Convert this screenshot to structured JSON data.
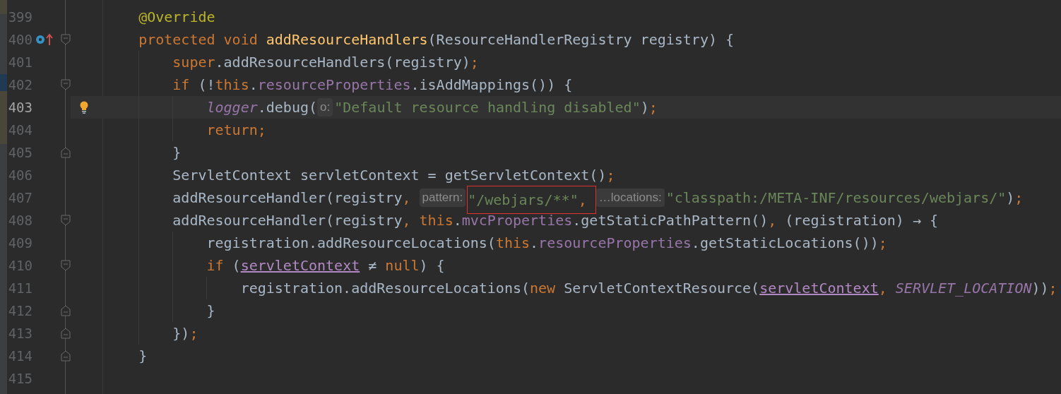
{
  "editor": {
    "lines": [
      {
        "number": "399",
        "current": false,
        "tokens": [
          {
            "kind": "annotation",
            "text": "@Override"
          }
        ]
      },
      {
        "number": "400",
        "current": false,
        "override_marker": true,
        "fold_start": true,
        "tokens": [
          {
            "kind": "keyword",
            "text": "protected void "
          },
          {
            "kind": "declaration",
            "text": "addResourceHandlers"
          },
          {
            "kind": "plain",
            "text": "(ResourceHandlerRegistry registry) {"
          }
        ],
        "children": [
          {
            "number": "401",
            "current": false,
            "tokens": [
              {
                "kind": "keyword",
                "text": "super"
              },
              {
                "kind": "plain",
                "text": ".addResourceHandlers(registry)"
              },
              {
                "kind": "keyword",
                "text": ";"
              }
            ]
          },
          {
            "number": "402",
            "current": false,
            "fold_start": true,
            "tokens": [
              {
                "kind": "keyword",
                "text": "if"
              },
              {
                "kind": "plain",
                "text": " (!"
              },
              {
                "kind": "keyword",
                "text": "this"
              },
              {
                "kind": "plain",
                "text": "."
              },
              {
                "kind": "field",
                "text": "resourceProperties"
              },
              {
                "kind": "plain",
                "text": ".isAddMappings()) {"
              }
            ],
            "children": [
              {
                "number": "403",
                "current": true,
                "bulb": true,
                "tokens": [
                  {
                    "kind": "static",
                    "text": "logger"
                  },
                  {
                    "kind": "plain",
                    "text": ".debug("
                  },
                  {
                    "kind": "hint",
                    "text": "o:"
                  },
                  {
                    "kind": "string",
                    "text": "\"Default resource handling disabled\""
                  },
                  {
                    "kind": "plain",
                    "text": ")"
                  },
                  {
                    "kind": "keyword",
                    "text": ";"
                  }
                ]
              },
              {
                "number": "404",
                "current": false,
                "tokens": [
                  {
                    "kind": "keyword",
                    "text": "return;"
                  }
                ]
              }
            ]
          },
          {
            "number": "405",
            "current": false,
            "fold_end": true,
            "tokens": [
              {
                "kind": "plain",
                "text": "}"
              }
            ]
          },
          {
            "number": "406",
            "current": false,
            "tokens": [
              {
                "kind": "plain",
                "text": "ServletContext servletContext = getServletContext()"
              },
              {
                "kind": "keyword",
                "text": ";"
              }
            ]
          },
          {
            "number": "407",
            "current": false,
            "tokens": [
              {
                "kind": "plain",
                "text": "addResourceHandler(registry"
              },
              {
                "kind": "keyword",
                "text": ", "
              },
              {
                "kind": "hint",
                "text": "pattern:"
              },
              {
                "kind": "string",
                "text": "\"/webjars/**\"",
                "outlined": true
              },
              {
                "kind": "keyword",
                "text": ", ",
                "outlined": true
              },
              {
                "kind": "hint",
                "text": "…locations:"
              },
              {
                "kind": "string",
                "text": "\"classpath:/META-INF/resources/webjars/\""
              },
              {
                "kind": "plain",
                "text": ")"
              },
              {
                "kind": "keyword",
                "text": ";"
              }
            ]
          },
          {
            "number": "408",
            "current": false,
            "fold_start": true,
            "tokens": [
              {
                "kind": "plain",
                "text": "addResourceHandler(registry"
              },
              {
                "kind": "keyword",
                "text": ", "
              },
              {
                "kind": "keyword",
                "text": "this"
              },
              {
                "kind": "plain",
                "text": "."
              },
              {
                "kind": "field",
                "text": "mvcProperties"
              },
              {
                "kind": "plain",
                "text": ".getStaticPathPattern()"
              },
              {
                "kind": "keyword",
                "text": ", "
              },
              {
                "kind": "plain",
                "text": "(registration) → {"
              }
            ],
            "children": [
              {
                "number": "409",
                "current": false,
                "tokens": [
                  {
                    "kind": "plain",
                    "text": "registration.addResourceLocations("
                  },
                  {
                    "kind": "keyword",
                    "text": "this"
                  },
                  {
                    "kind": "plain",
                    "text": "."
                  },
                  {
                    "kind": "field",
                    "text": "resourceProperties"
                  },
                  {
                    "kind": "plain",
                    "text": ".getStaticLocations())"
                  },
                  {
                    "kind": "keyword",
                    "text": ";"
                  }
                ]
              },
              {
                "number": "410",
                "current": false,
                "fold_start": true,
                "tokens": [
                  {
                    "kind": "keyword",
                    "text": "if"
                  },
                  {
                    "kind": "plain",
                    "text": " ("
                  },
                  {
                    "kind": "captured",
                    "text": "servletContext"
                  },
                  {
                    "kind": "plain",
                    "text": " ≠ "
                  },
                  {
                    "kind": "keyword",
                    "text": "null"
                  },
                  {
                    "kind": "plain",
                    "text": ") {"
                  }
                ],
                "children": [
                  {
                    "number": "411",
                    "current": false,
                    "tokens": [
                      {
                        "kind": "plain",
                        "text": "registration.addResourceLocations("
                      },
                      {
                        "kind": "keyword",
                        "text": "new"
                      },
                      {
                        "kind": "plain",
                        "text": " ServletContextResource("
                      },
                      {
                        "kind": "captured",
                        "text": "servletContext"
                      },
                      {
                        "kind": "keyword",
                        "text": ", "
                      },
                      {
                        "kind": "static",
                        "text": "SERVLET_LOCATION"
                      },
                      {
                        "kind": "plain",
                        "text": "))"
                      },
                      {
                        "kind": "keyword",
                        "text": ";"
                      }
                    ]
                  }
                ]
              },
              {
                "number": "412",
                "current": false,
                "fold_end": true,
                "tokens": [
                  {
                    "kind": "plain",
                    "text": "}"
                  }
                ]
              }
            ]
          },
          {
            "number": "413",
            "current": false,
            "fold_end": true,
            "tokens": [
              {
                "kind": "plain",
                "text": "})"
              },
              {
                "kind": "keyword",
                "text": ";"
              }
            ]
          }
        ]
      },
      {
        "number": "414",
        "current": false,
        "fold_end": true,
        "tokens": [
          {
            "kind": "plain",
            "text": "}"
          }
        ]
      },
      {
        "number": "415",
        "current": false
      }
    ]
  }
}
